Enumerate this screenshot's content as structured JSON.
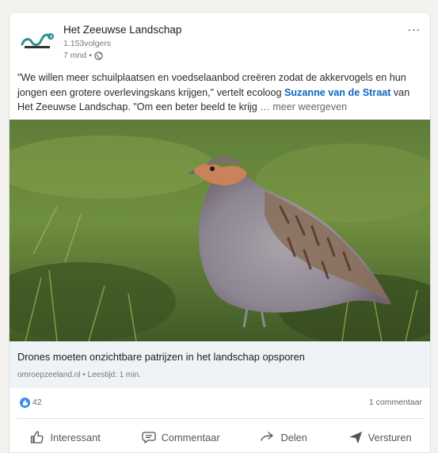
{
  "post": {
    "author": "Het Zeeuwse Landschap",
    "followers": "1.153volgers",
    "age": "7 mnd",
    "separator": "•",
    "text_part1": "\"We willen meer schuilplaatsen en voedselaanbod creëren zodat de akkervogels en hun jongen een grotere overlevingskans krijgen,\" vertelt ecoloog ",
    "mention": "Suzanne van de Straat",
    "text_part2": " van Het Zeeuwse Landschap. \"Om een beter beeld te krijg",
    "see_more": "… meer weergeven",
    "more_icon": "..."
  },
  "link_preview": {
    "title": "Drones moeten onzichtbare patrijzen in het landschap opsporen",
    "source": "omroepzeeland.nl • Leestijd: 1 min."
  },
  "social": {
    "likes": "42",
    "comments": "1 commentaar"
  },
  "actions": {
    "like": "Interessant",
    "comment": "Commentaar",
    "share": "Delen",
    "send": "Versturen"
  },
  "colors": {
    "accent": "#0a66c2",
    "like_badge": "#378fe9",
    "link_box_bg": "#eef3f8"
  }
}
